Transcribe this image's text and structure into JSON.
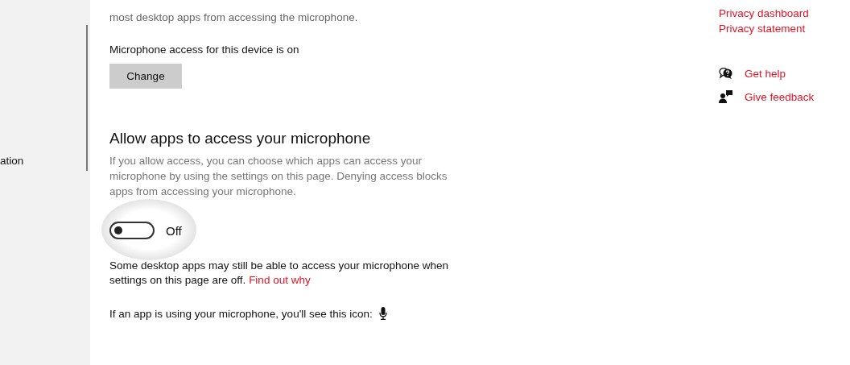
{
  "sidebar": {
    "items": [
      {
        "label": "ation"
      }
    ]
  },
  "main": {
    "intro_lines": [
      "most desktop apps from accessing the microphone."
    ],
    "device_status": "Microphone access for this device is on",
    "change_button": "Change",
    "section_title": "Allow apps to access your microphone",
    "section_description": "If you allow access, you can choose which apps can access your microphone by using the settings on this page. Denying access blocks apps from accessing your microphone.",
    "toggle": {
      "on": false,
      "label": "Off",
      "highlighted": true
    },
    "note": "Some desktop apps may still be able to access your microphone when settings on this page are off.",
    "note_link": "Find out why",
    "icon_note": "If an app is using your microphone, you'll see this icon:"
  },
  "related": {
    "links": [
      "Privacy dashboard",
      "Privacy statement"
    ],
    "help": [
      {
        "kind": "help",
        "label": "Get help"
      },
      {
        "kind": "feedback",
        "label": "Give feedback"
      }
    ]
  }
}
